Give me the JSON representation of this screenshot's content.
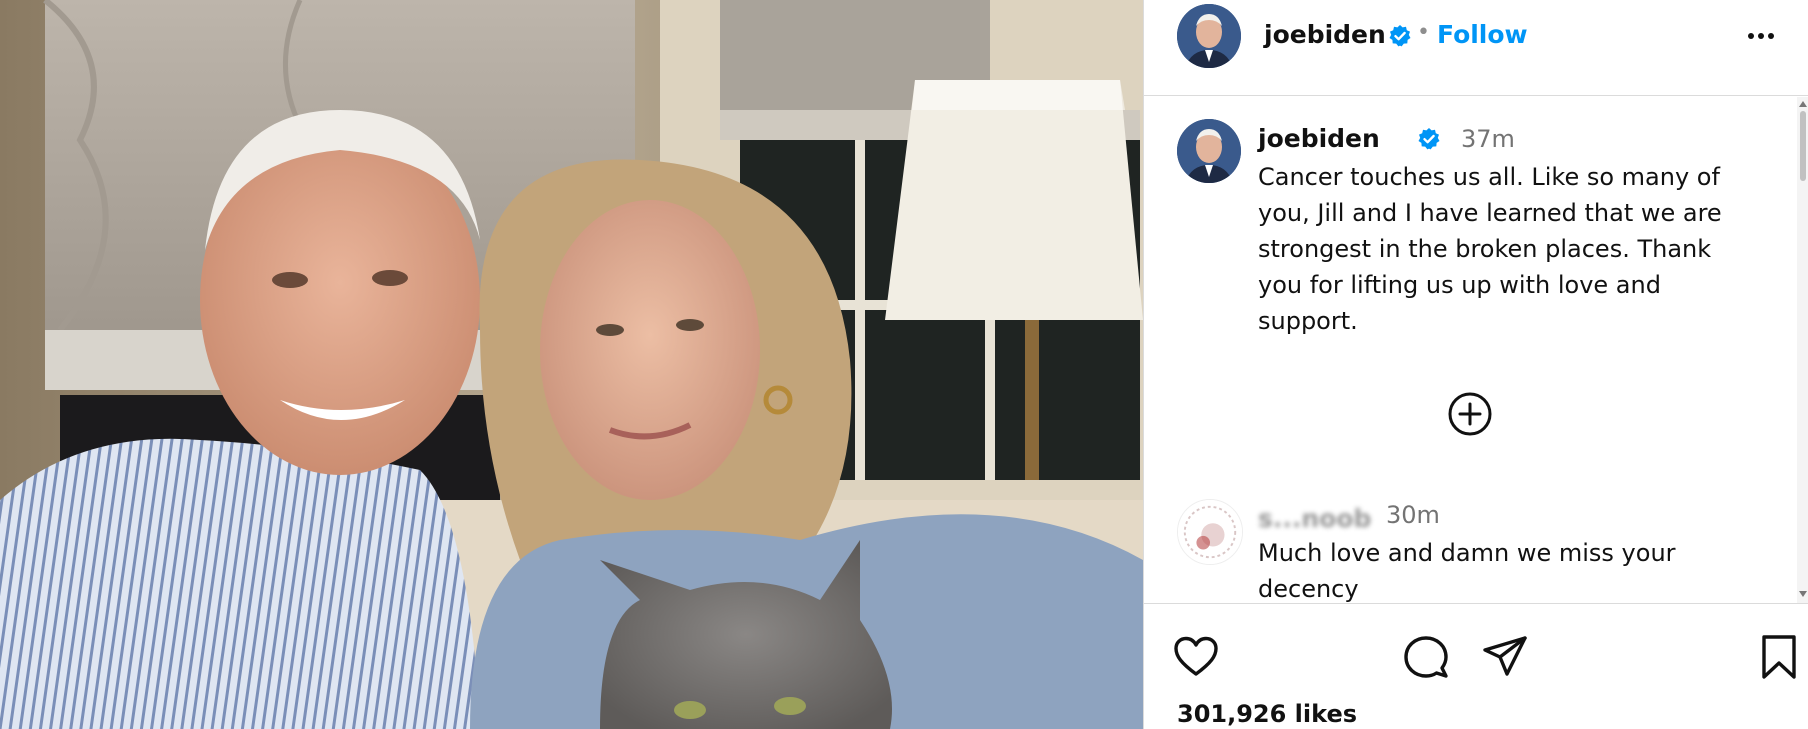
{
  "post": {
    "author": "joebiden",
    "follow_label": "Follow",
    "separator": "•",
    "caption": {
      "author": "joebiden",
      "time": "37m",
      "text": "Cancer touches us all. Like so many of you, Jill and I have learned that we are strongest in the broken places. Thank you for lifting us up with love and support."
    },
    "comments": [
      {
        "author": "s...noob",
        "time": "30m",
        "text": "Much love and damn we miss your decency"
      }
    ],
    "likes": "301,926 likes"
  },
  "icons": {
    "verified": "verified-badge-icon",
    "more": "more-options-icon",
    "load_more": "plus-circle-icon",
    "like": "heart-icon",
    "comment": "comment-bubble-icon",
    "share": "paper-plane-icon",
    "save": "bookmark-icon"
  },
  "colors": {
    "accent": "#0095f6",
    "verified": "#0095f6",
    "muted": "#737373"
  }
}
